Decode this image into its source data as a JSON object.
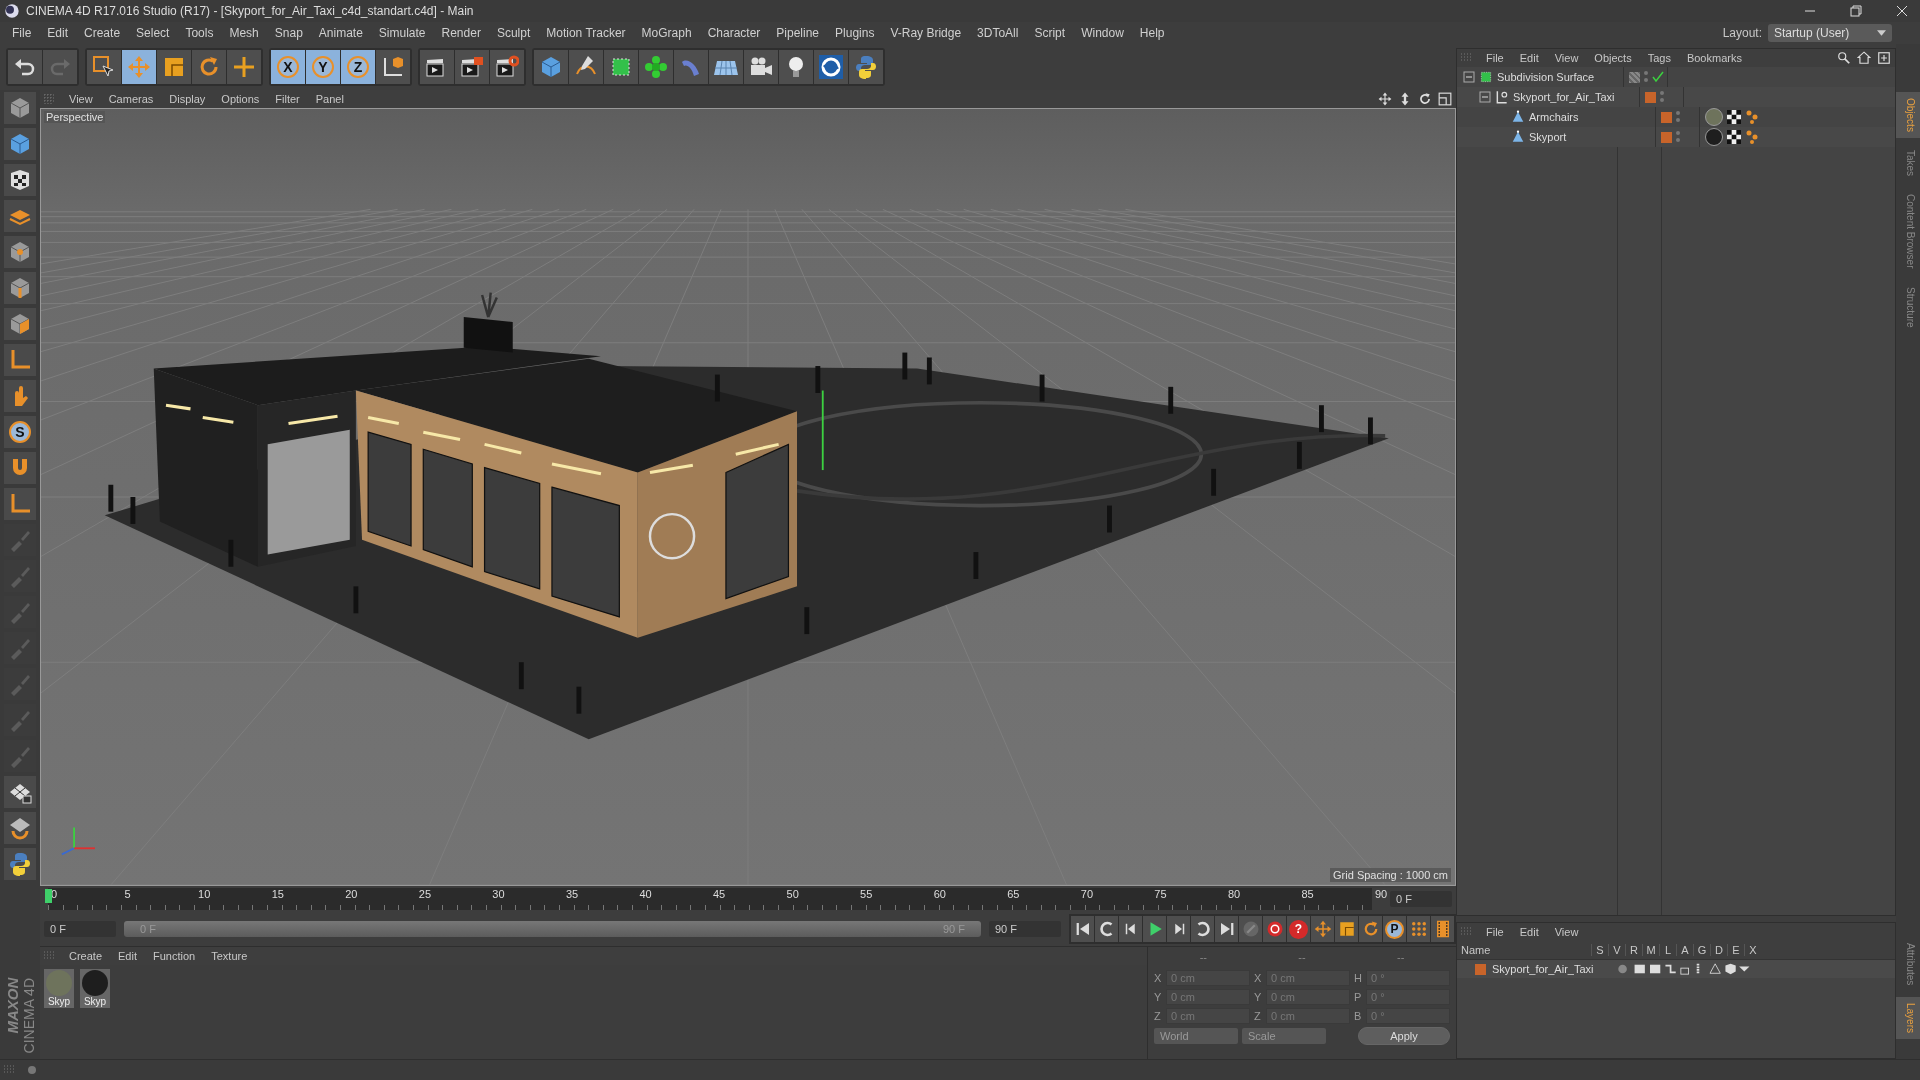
{
  "window": {
    "title": "CINEMA 4D R17.016 Studio (R17) - [Skyport_for_Air_Taxi_c4d_standart.c4d] - Main"
  },
  "menu": [
    "File",
    "Edit",
    "Create",
    "Select",
    "Tools",
    "Mesh",
    "Snap",
    "Animate",
    "Simulate",
    "Render",
    "Sculpt",
    "Motion Tracker",
    "MoGraph",
    "Character",
    "Pipeline",
    "Plugins",
    "V-Ray Bridge",
    "3DToAll",
    "Script",
    "Window",
    "Help"
  ],
  "layout": {
    "label": "Layout:",
    "value": "Startup (User)"
  },
  "toolbar": [
    [
      {
        "kind": "undo",
        "selected": false
      },
      {
        "kind": "redo",
        "selected": false
      }
    ],
    [
      {
        "kind": "select",
        "selected": false
      },
      {
        "kind": "move",
        "selected": true
      },
      {
        "kind": "scale",
        "selected": false
      },
      {
        "kind": "rotate",
        "selected": false
      },
      {
        "kind": "plus",
        "selected": false
      }
    ],
    [
      {
        "kind": "letter",
        "label": "X",
        "selected": true
      },
      {
        "kind": "letter",
        "label": "Y",
        "selected": true
      },
      {
        "kind": "letter",
        "label": "Z",
        "selected": true
      },
      {
        "kind": "axes",
        "selected": false
      }
    ],
    [
      {
        "kind": "clapper",
        "selected": false
      },
      {
        "kind": "clapper2",
        "selected": false
      },
      {
        "kind": "clapper3",
        "selected": false
      }
    ],
    [
      {
        "kind": "cube",
        "selected": false
      },
      {
        "kind": "pen",
        "selected": false
      },
      {
        "kind": "gcube",
        "selected": false
      },
      {
        "kind": "flower",
        "selected": false
      },
      {
        "kind": "bend",
        "selected": false
      },
      {
        "kind": "floor",
        "selected": false
      },
      {
        "kind": "camera",
        "selected": false
      },
      {
        "kind": "bulb",
        "selected": false
      },
      {
        "kind": "sketch",
        "selected": false
      },
      {
        "kind": "snake",
        "selected": false
      }
    ]
  ],
  "left_tools": [
    {
      "kind": "cube-grey",
      "disabled": false
    },
    {
      "kind": "cube",
      "disabled": false
    },
    {
      "kind": "checker",
      "disabled": false
    },
    {
      "kind": "layers",
      "disabled": false
    },
    {
      "kind": "point-cube",
      "disabled": false
    },
    {
      "kind": "edge-cube",
      "disabled": false
    },
    {
      "kind": "poly-cube",
      "disabled": false
    },
    {
      "kind": "axis-l",
      "disabled": false
    },
    {
      "kind": "hand",
      "disabled": false
    },
    {
      "kind": "letter",
      "label": "S",
      "disabled": false
    },
    {
      "kind": "magnet",
      "disabled": false
    },
    {
      "kind": "axis-l",
      "disabled": false
    },
    {
      "kind": "brush",
      "disabled": true
    },
    {
      "kind": "brush",
      "disabled": true
    },
    {
      "kind": "brush",
      "disabled": true
    },
    {
      "kind": "brush",
      "disabled": true
    },
    {
      "kind": "brush",
      "disabled": true
    },
    {
      "kind": "brush",
      "disabled": true
    },
    {
      "kind": "brush",
      "disabled": true
    },
    {
      "kind": "grid-lock",
      "disabled": false
    },
    {
      "kind": "grid-rotate",
      "disabled": false
    },
    {
      "kind": "snake",
      "disabled": false
    }
  ],
  "logo": {
    "brand": "MAXON",
    "product": "CINEMA 4D"
  },
  "viewport": {
    "menu": [
      "View",
      "Cameras",
      "Display",
      "Options",
      "Filter",
      "Panel"
    ],
    "camera": "Perspective",
    "grid_spacing": "Grid Spacing : 1000 cm"
  },
  "timeline": {
    "labels": [
      "0",
      "5",
      "10",
      "15",
      "20",
      "25",
      "30",
      "35",
      "40",
      "45",
      "50",
      "55",
      "60",
      "65",
      "70",
      "75",
      "80",
      "85",
      "90"
    ],
    "level": 0,
    "frame": "0 F"
  },
  "range": {
    "start": "0 F",
    "slider_start": "0 F",
    "slider_end": "90 F",
    "end": "90 F",
    "level": 1
  },
  "transport": [
    {
      "kind": "first"
    },
    {
      "kind": "prevkey"
    },
    {
      "kind": "prev"
    },
    {
      "kind": "play"
    },
    {
      "kind": "next"
    },
    {
      "kind": "nextkey"
    },
    {
      "kind": "last"
    },
    {
      "kind": "keygrey"
    },
    {
      "kind": "record"
    },
    {
      "kind": "help",
      "label": "?"
    },
    {
      "kind": "move"
    },
    {
      "kind": "scale"
    },
    {
      "kind": "rotate"
    },
    {
      "kind": "letter",
      "label": "P"
    },
    {
      "kind": "dots"
    },
    {
      "kind": "film"
    }
  ],
  "materials": {
    "menu": [
      "Create",
      "Edit",
      "Function",
      "Texture"
    ],
    "items": [
      {
        "name": "Skyp",
        "color": "#6e735c"
      },
      {
        "name": "Skyp",
        "color": "#1e1e1e"
      }
    ]
  },
  "coordinates": {
    "headers": [
      "--",
      "--",
      "--"
    ],
    "rows": [
      {
        "axis": "X",
        "position": "0 cm",
        "size_axis": "X",
        "size": "0 cm",
        "rot_axis": "H",
        "rotation": "0 °"
      },
      {
        "axis": "Y",
        "position": "0 cm",
        "size_axis": "Y",
        "size": "0 cm",
        "rot_axis": "P",
        "rotation": "0 °"
      },
      {
        "axis": "Z",
        "position": "0 cm",
        "size_axis": "Z",
        "size": "0 cm",
        "rot_axis": "B",
        "rotation": "0 °"
      }
    ],
    "dropdowns": [
      "World",
      "Scale"
    ],
    "apply": "Apply"
  },
  "objects": {
    "menu": [
      "File",
      "Edit",
      "View",
      "Objects",
      "Tags",
      "Bookmarks"
    ],
    "tree": [
      {
        "name": "Subdivision Surface",
        "kind": "subdivision",
        "expanded": true,
        "checked": true,
        "selected": false,
        "children": [
          {
            "name": "Skyport_for_Air_Taxi",
            "kind": "null",
            "expanded": true,
            "checked": false,
            "selected": false,
            "color": "#c8642a",
            "children": [
              {
                "name": "Armchairs",
                "kind": "polygon",
                "checked": false,
                "selected": false,
                "color": "#c8642a",
                "tags": [
                  {
                    "kind": "material",
                    "color": "#6e735c"
                  },
                  {
                    "kind": "checker"
                  },
                  {
                    "kind": "dots"
                  }
                ]
              },
              {
                "name": "Skyport",
                "kind": "polygon",
                "checked": false,
                "selected": false,
                "color": "#c8642a",
                "tags": [
                  {
                    "kind": "material",
                    "color": "#1e1e1e"
                  },
                  {
                    "kind": "checker"
                  },
                  {
                    "kind": "dots"
                  }
                ]
              }
            ]
          }
        ]
      }
    ]
  },
  "layers": {
    "menu": [
      "File",
      "Edit",
      "View"
    ],
    "columns": [
      "Name",
      "S",
      "V",
      "R",
      "M",
      "L",
      "A",
      "G",
      "D",
      "E",
      "X"
    ],
    "rows": [
      {
        "name": "Skyport_for_Air_Taxi",
        "color": "#c8642a"
      }
    ]
  },
  "side_tabs_top": [
    {
      "label": "Objects",
      "selected": true
    },
    {
      "label": "Takes",
      "selected": false
    },
    {
      "label": "Content Browser",
      "selected": false
    },
    {
      "label": "Structure",
      "selected": false
    }
  ],
  "side_tabs_bottom": [
    {
      "label": "Attributes",
      "selected": false
    },
    {
      "label": "Layers",
      "selected": true
    }
  ]
}
